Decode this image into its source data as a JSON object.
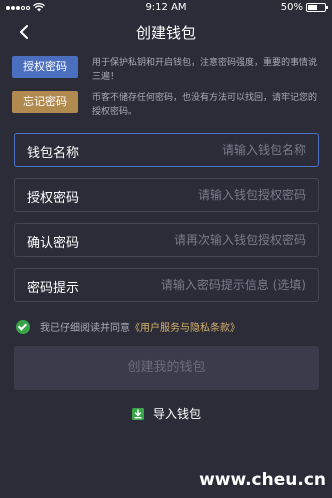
{
  "statusbar": {
    "time": "9:12 AM",
    "battery": "50%",
    "battery_level": 0.5
  },
  "nav": {
    "title": "创建钱包"
  },
  "tips": [
    {
      "tag": "授权密码",
      "tag_color": "#4a6fbf",
      "desc": "用于保护私钥和开启钱包，注意密码强度，重要的事情说三遍！"
    },
    {
      "tag": "忘记密码",
      "tag_color": "#b08a4f",
      "desc": "币客不储存任何密码，也没有方法可以找回，请牢记您的授权密码。"
    }
  ],
  "fields": [
    {
      "label": "钱包名称",
      "placeholder": "请输入钱包名称"
    },
    {
      "label": "授权密码",
      "placeholder": "请输入钱包授权密码"
    },
    {
      "label": "确认密码",
      "placeholder": "请再次输入钱包授权密码"
    },
    {
      "label": "密码提示",
      "placeholder": "请输入密码提示信息 (选填)"
    }
  ],
  "agreement": {
    "prefix": "我已仔细阅读并同意",
    "link": "《用户服务与隐私条款》",
    "checked": true
  },
  "create_button": "创建我的钱包",
  "import_wallet": "导入钱包",
  "watermark": "www.cheu.cn",
  "colors": {
    "background": "#2b2c38",
    "accent_blue": "#4f76c6",
    "check_green": "#3aa44a",
    "link_gold": "#d6b06a"
  }
}
